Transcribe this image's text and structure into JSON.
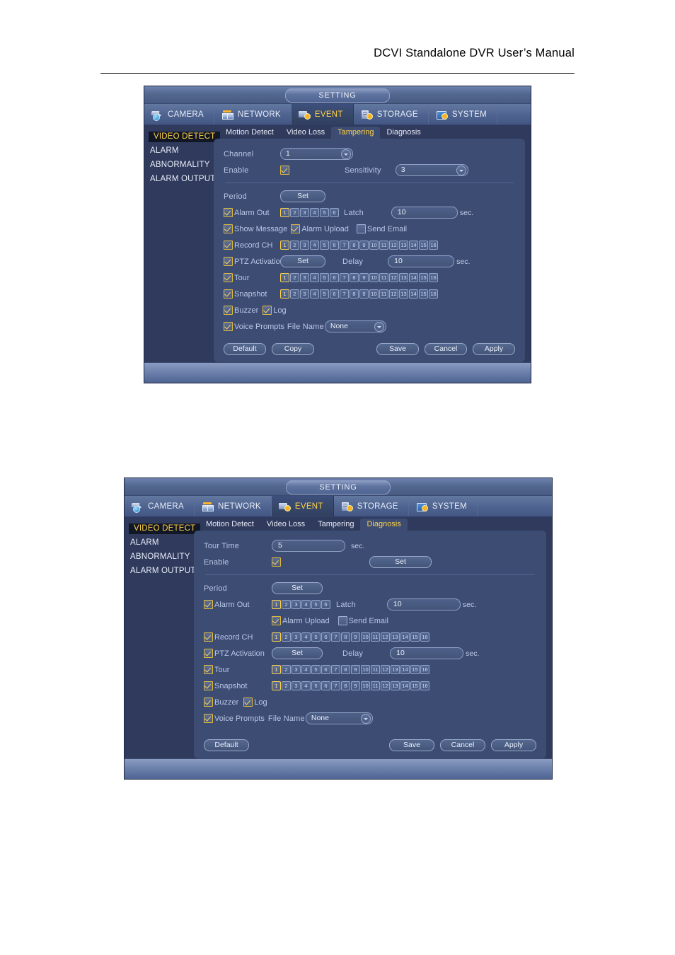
{
  "page": {
    "header_title": "DCVI Standalone DVR User’s Manual"
  },
  "common": {
    "window_title": "SETTING",
    "main_tabs": [
      {
        "label": "CAMERA",
        "icon": "camera-icon",
        "active": false
      },
      {
        "label": "NETWORK",
        "icon": "network-icon",
        "active": false
      },
      {
        "label": "EVENT",
        "icon": "event-icon",
        "active": true
      },
      {
        "label": "STORAGE",
        "icon": "storage-icon",
        "active": false
      },
      {
        "label": "SYSTEM",
        "icon": "system-icon",
        "active": false
      }
    ],
    "sidebar": [
      {
        "label": "VIDEO DETECT",
        "active": true
      },
      {
        "label": "ALARM",
        "active": false
      },
      {
        "label": "ABNORMALITY",
        "active": false
      },
      {
        "label": "ALARM OUTPUT",
        "active": false
      }
    ],
    "sub_tabs": [
      "Motion Detect",
      "Video Loss",
      "Tampering",
      "Diagnosis"
    ],
    "labels": {
      "channel": "Channel",
      "enable": "Enable",
      "sensitivity": "Sensitivity",
      "period": "Period",
      "alarm_out": "Alarm Out",
      "latch": "Latch",
      "show_message": "Show Message",
      "alarm_upload": "Alarm Upload",
      "send_email": "Send Email",
      "record_ch": "Record CH",
      "ptz_activation": "PTZ Activation",
      "delay": "Delay",
      "tour": "Tour",
      "snapshot": "Snapshot",
      "buzzer": "Buzzer",
      "log": "Log",
      "voice_prompts": "Voice Prompts",
      "file_name": "File Name",
      "tour_time": "Tour Time",
      "set": "Set",
      "sec": "sec."
    },
    "buttons": {
      "default": "Default",
      "copy": "Copy",
      "save": "Save",
      "cancel": "Cancel",
      "apply": "Apply"
    },
    "channels_6": [
      "1",
      "2",
      "3",
      "4",
      "5",
      "6"
    ],
    "channels_16": [
      "1",
      "2",
      "3",
      "4",
      "5",
      "6",
      "7",
      "8",
      "9",
      "10",
      "11",
      "12",
      "13",
      "14",
      "15",
      "16"
    ],
    "colors": {
      "accent_yellow": "#ffd24a",
      "panel_blue": "#3c4c73",
      "dialog_blue": "#2f3a5c",
      "label_blue": "#b9c6e6"
    }
  },
  "dialog1": {
    "active_sub_tab": "Tampering",
    "channel_value": "1",
    "enable_checked": true,
    "sensitivity_value": "3",
    "period_set": "Set",
    "alarm_out_checked": true,
    "alarm_out_selected": "1",
    "latch_value": "10",
    "show_message_checked": true,
    "alarm_upload_checked": true,
    "send_email_checked": false,
    "record_ch_checked": true,
    "record_ch_selected": "1",
    "ptz_checked": true,
    "ptz_set": "Set",
    "delay_value": "10",
    "tour_checked": true,
    "tour_selected": "1",
    "snapshot_checked": true,
    "snapshot_selected": "1",
    "buzzer_checked": true,
    "log_checked": true,
    "voice_prompts_checked": true,
    "file_name_value": "None"
  },
  "dialog2": {
    "active_sub_tab": "Diagnosis",
    "tour_time_value": "5",
    "enable_checked": true,
    "enable_set": "Set",
    "period_set": "Set",
    "alarm_out_checked": true,
    "alarm_out_selected": "1",
    "latch_value": "10",
    "alarm_upload_checked": true,
    "send_email_checked": false,
    "record_ch_checked": true,
    "record_ch_selected": "1",
    "ptz_checked": true,
    "ptz_set": "Set",
    "delay_value": "10",
    "tour_checked": true,
    "tour_selected": "1",
    "snapshot_checked": true,
    "snapshot_selected": "1",
    "buzzer_checked": true,
    "log_checked": true,
    "voice_prompts_checked": true,
    "file_name_value": "None"
  }
}
